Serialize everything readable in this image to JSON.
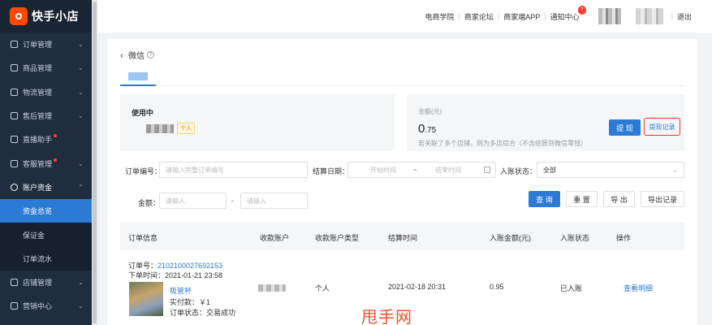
{
  "brand": {
    "name": "快手小店"
  },
  "sidebar": {
    "items": [
      {
        "label": "订单管理",
        "icon": "order-icon",
        "dot": false
      },
      {
        "label": "商品管理",
        "icon": "goods-icon",
        "dot": false
      },
      {
        "label": "物流管理",
        "icon": "truck-icon",
        "dot": false
      },
      {
        "label": "售后管理",
        "icon": "shield-icon",
        "dot": false
      },
      {
        "label": "直播助手",
        "icon": "live-icon",
        "dot": true
      },
      {
        "label": "客服管理",
        "icon": "service-icon",
        "dot": true
      },
      {
        "label": "账户资金",
        "icon": "money-icon",
        "dot": false,
        "open": true
      },
      {
        "label": "店铺管理",
        "icon": "store-icon",
        "dot": false
      },
      {
        "label": "营销中心",
        "icon": "marketing-icon",
        "dot": false
      }
    ],
    "sub_items": [
      {
        "label": "资金总览",
        "active": true
      },
      {
        "label": "保证金",
        "active": false
      },
      {
        "label": "订单流水",
        "active": false
      }
    ]
  },
  "header": {
    "links": [
      "电商学院",
      "商家论坛",
      "商家端APP"
    ],
    "notify_label": "通知中心",
    "notify_count": "7",
    "logout_label": "退出"
  },
  "page": {
    "back_title": "微信"
  },
  "account_panel": {
    "status_label": "使用中",
    "tag_label": "个人"
  },
  "balance_panel": {
    "label": "余额(元)",
    "value_main": "0",
    "value_decimal": ".75",
    "note": "若关联了多个店铺，则为多店综合（不含结算到微信零钱）",
    "withdraw_label": "提 现",
    "record_label": "提现记录"
  },
  "filters": {
    "order_no_label": "订单编号：",
    "order_no_placeholder": "请输入完整订单编号",
    "settle_date_label": "结算日期：",
    "start_placeholder": "开始时间",
    "range_sep": "~",
    "end_placeholder": "结束时间",
    "status_label": "入账状态：",
    "status_value": "全部",
    "amount_label": "金额：",
    "amount_min_placeholder": "请输入",
    "amount_sep": "-",
    "amount_max_placeholder": "请输入",
    "query_label": "查 询",
    "reset_label": "重 置",
    "export_label": "导 出",
    "export_record_label": "导出记录"
  },
  "table": {
    "headers": [
      "订单信息",
      "收款账户",
      "收款账户类型",
      "结算时间",
      "入账金额(元)",
      "入账状态",
      "操作"
    ],
    "rows": [
      {
        "order_no_label": "订单号：",
        "order_no": "2102100027692153",
        "order_time": "下单时间：2021-01-21 23:58",
        "product_name": "吸管杯",
        "paid": "实付款：￥1",
        "order_status": "订单状态：交易成功",
        "account_type": "个人",
        "settle_time": "2021-02-18 20:31",
        "amount": "0.95",
        "status": "已入账",
        "action": "查看明细"
      }
    ]
  },
  "watermark": "甩手网"
}
